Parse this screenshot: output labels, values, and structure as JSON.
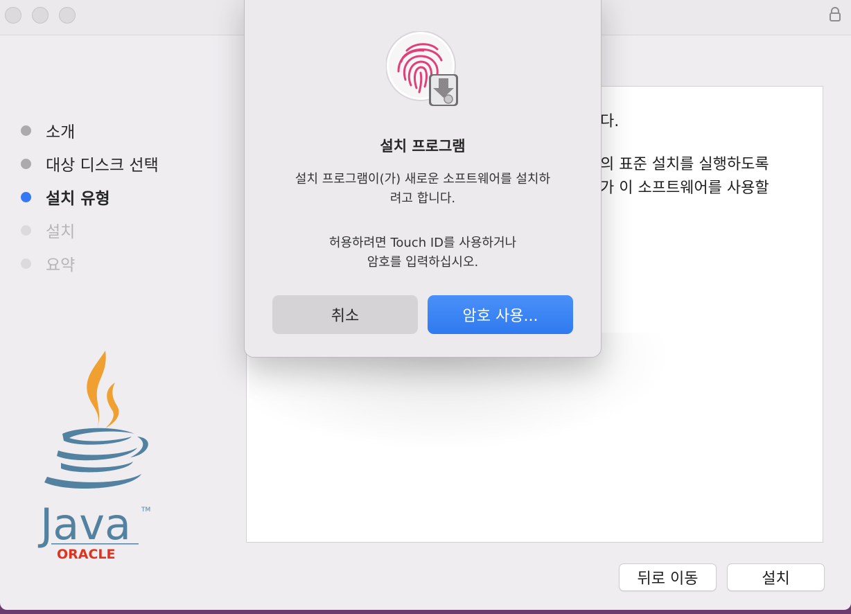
{
  "sidebar": {
    "steps": [
      {
        "label": "소개",
        "state": "done"
      },
      {
        "label": "대상 디스크 선택",
        "state": "done"
      },
      {
        "label": "설치 유형",
        "state": "active"
      },
      {
        "label": "설치",
        "state": "todo"
      },
      {
        "label": "요약",
        "state": "todo"
      }
    ]
  },
  "logo": {
    "wordmark": "Java",
    "tm": "TM",
    "vendor": "ORACLE"
  },
  "content": {
    "line1": "다.",
    "line2": "의 표준 설치를 실행하도록",
    "line3": "가 이 소프트웨어를 사용할"
  },
  "footer": {
    "back_label": "뒤로 이동",
    "install_label": "설치"
  },
  "dialog": {
    "title": "설치 프로그램",
    "message_line1": "설치 프로그램이(가) 새로운 소프트웨어를 설치하",
    "message_line2": "려고 합니다.",
    "hint_line1": "허용하려면 Touch ID를 사용하거나",
    "hint_line2": "암호를 입력하십시오.",
    "cancel_label": "취소",
    "use_password_label": "암호 사용..."
  },
  "colors": {
    "accent": "#3478f6",
    "java_orange": "#f0a030",
    "java_blue": "#5382a1",
    "oracle_red": "#e0321f",
    "fingerprint": "#e0407a"
  },
  "icons": [
    "lock-icon",
    "fingerprint-icon",
    "installer-disk-icon"
  ]
}
